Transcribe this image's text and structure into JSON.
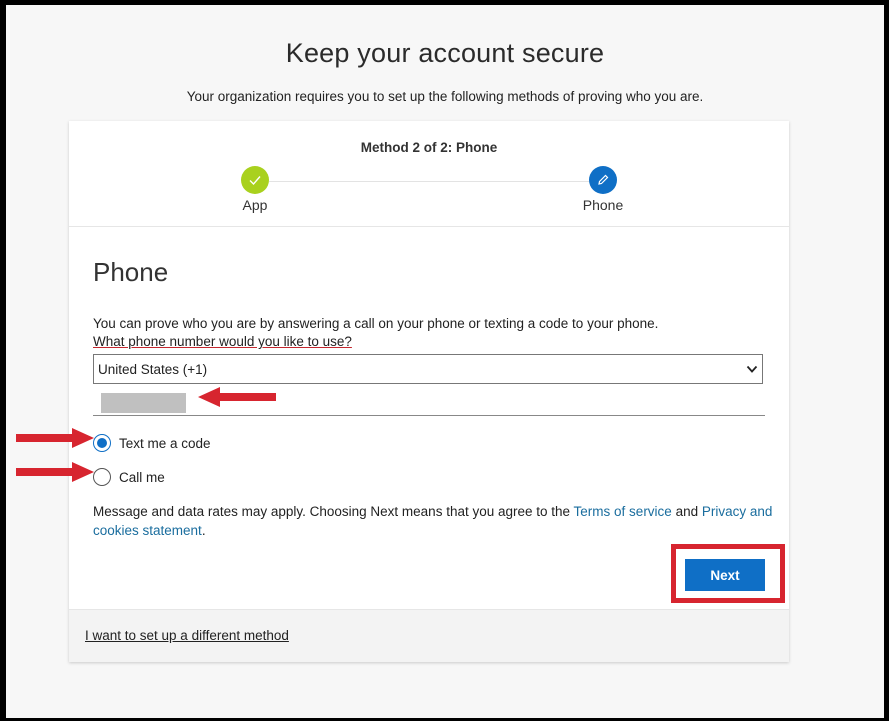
{
  "header": {
    "title": "Keep your account secure",
    "subtitle": "Your organization requires you to set up the following methods of proving who you are."
  },
  "progress": {
    "method_label": "Method 2 of 2: Phone",
    "steps": [
      {
        "label": "App",
        "status": "complete",
        "icon": "checkmark-icon",
        "color": "#a9d11e"
      },
      {
        "label": "Phone",
        "status": "current",
        "icon": "pencil-icon",
        "color": "#0f6fc6"
      }
    ]
  },
  "phone_section": {
    "title": "Phone",
    "description": "You can prove who you are by answering a call on your phone or texting a code to your phone.",
    "question": "What phone number would you like to use?",
    "country_select": {
      "selected": "United States (+1)"
    },
    "phone_number": {
      "value": "[redacted]"
    },
    "options": [
      {
        "label": "Text me a code",
        "selected": true
      },
      {
        "label": "Call me",
        "selected": false
      }
    ],
    "legal": {
      "prefix": "Message and data rates may apply. Choosing Next means that you agree to the ",
      "terms_link": "Terms of service",
      "middle": " and ",
      "privacy_link": "Privacy and cookies statement",
      "suffix": "."
    },
    "next_label": "Next"
  },
  "footer": {
    "different_method_link": "I want to set up a different method"
  },
  "colors": {
    "accent": "#0f6fc6",
    "complete": "#a9d11e",
    "link": "#1a6d9e",
    "annotation": "#d7252f"
  }
}
